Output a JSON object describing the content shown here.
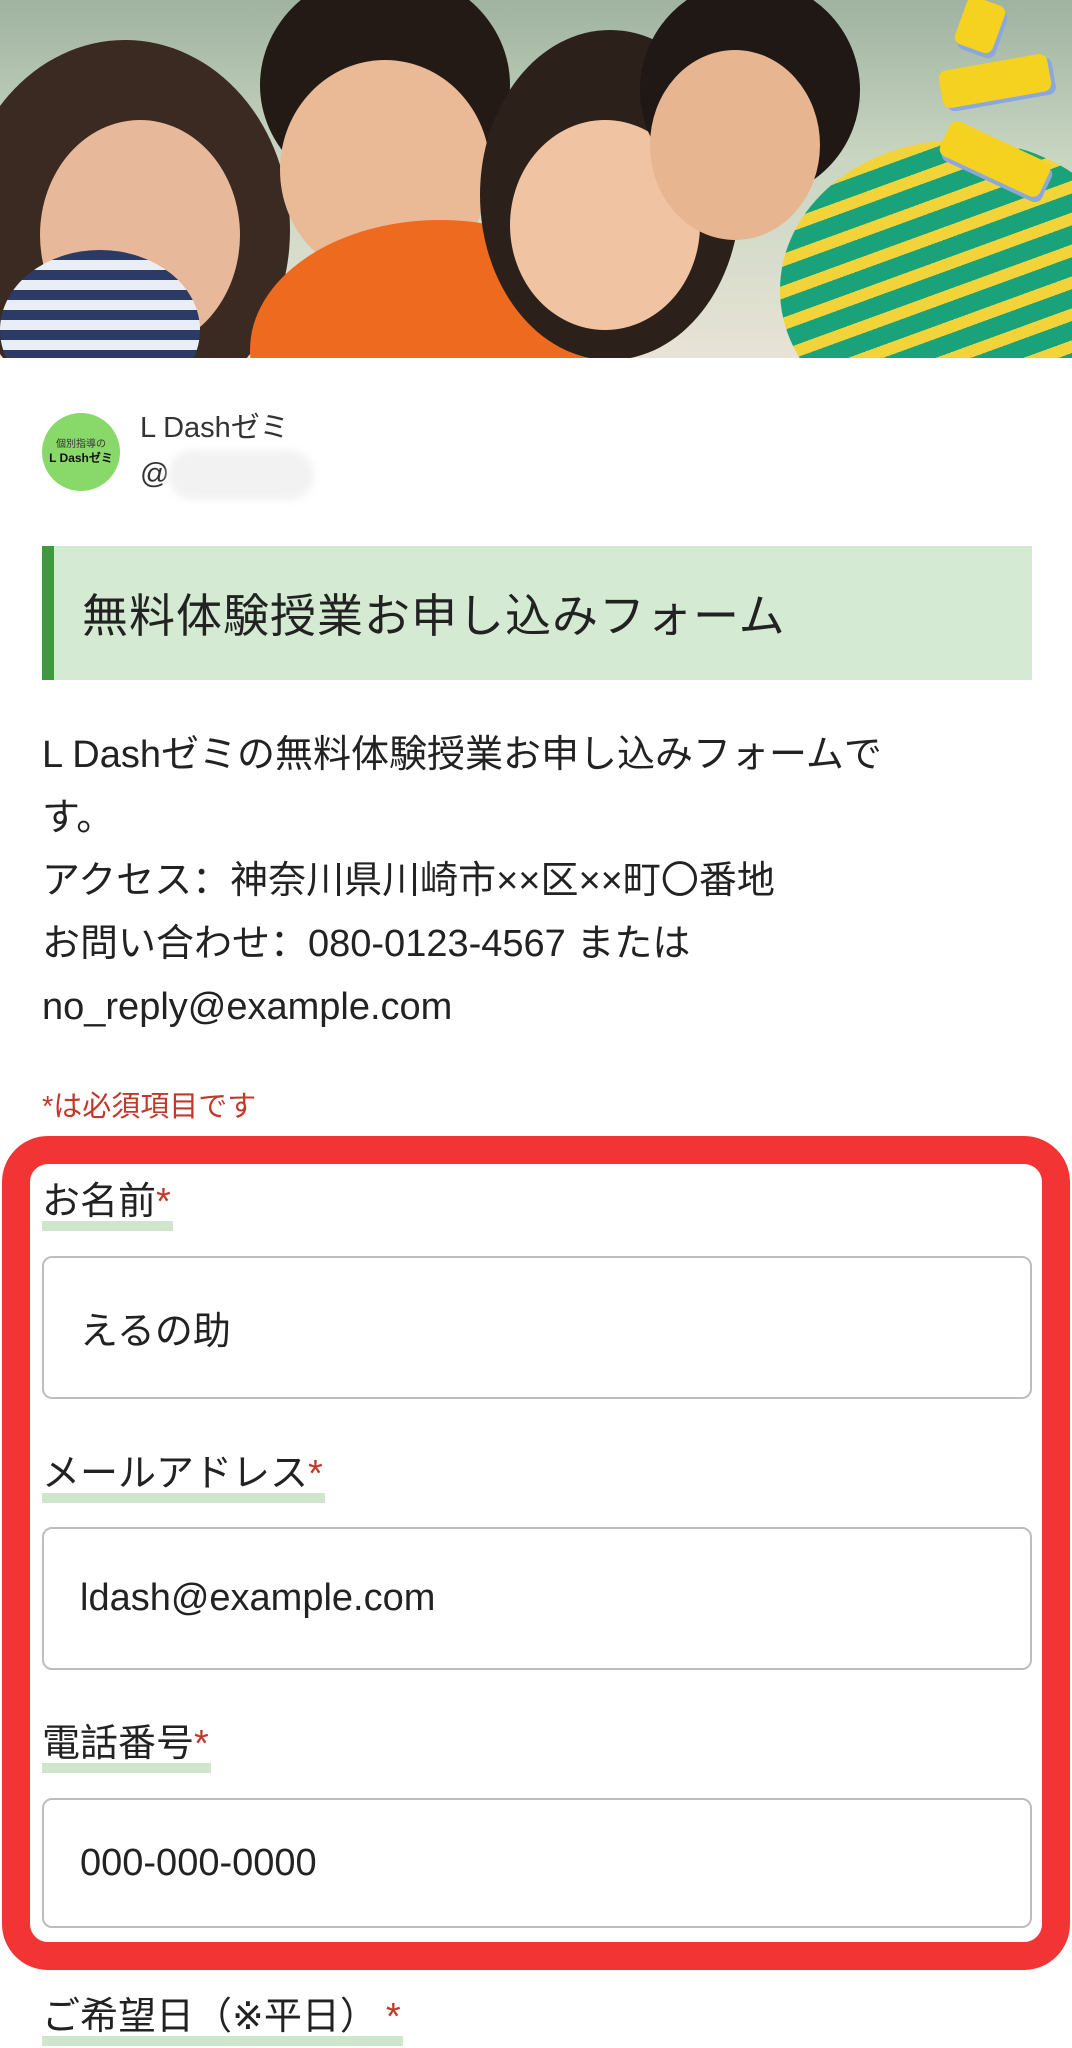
{
  "account": {
    "avatar_small_text": "個別指導の",
    "avatar_main_text": "L Dashゼミ",
    "name": "L Dashゼミ",
    "handle_prefix": "@"
  },
  "form": {
    "title": "無料体験授業お申し込みフォーム",
    "description_lines": [
      "L Dashゼミの無料体験授業お申し込みフォームで",
      "す。",
      "アクセス：神奈川県川崎市××区××町〇番地",
      "お問い合わせ：080-0123-4567 または",
      "no_reply@example.com"
    ],
    "required_note": "*は必須項目です",
    "required_mark": "*",
    "fields": [
      {
        "label": "お名前",
        "value": "えるの助"
      },
      {
        "label": "メールアドレス",
        "value": "ldash@example.com"
      },
      {
        "label": "電話番号",
        "value": "000-000-0000"
      },
      {
        "label": "ご希望日（※平日）"
      }
    ]
  },
  "colors": {
    "title_bg": "#d4ead3",
    "title_bar": "#3f9a3f",
    "required": "#c0392b",
    "highlight": "#f23434",
    "avatar": "#88d86a"
  }
}
